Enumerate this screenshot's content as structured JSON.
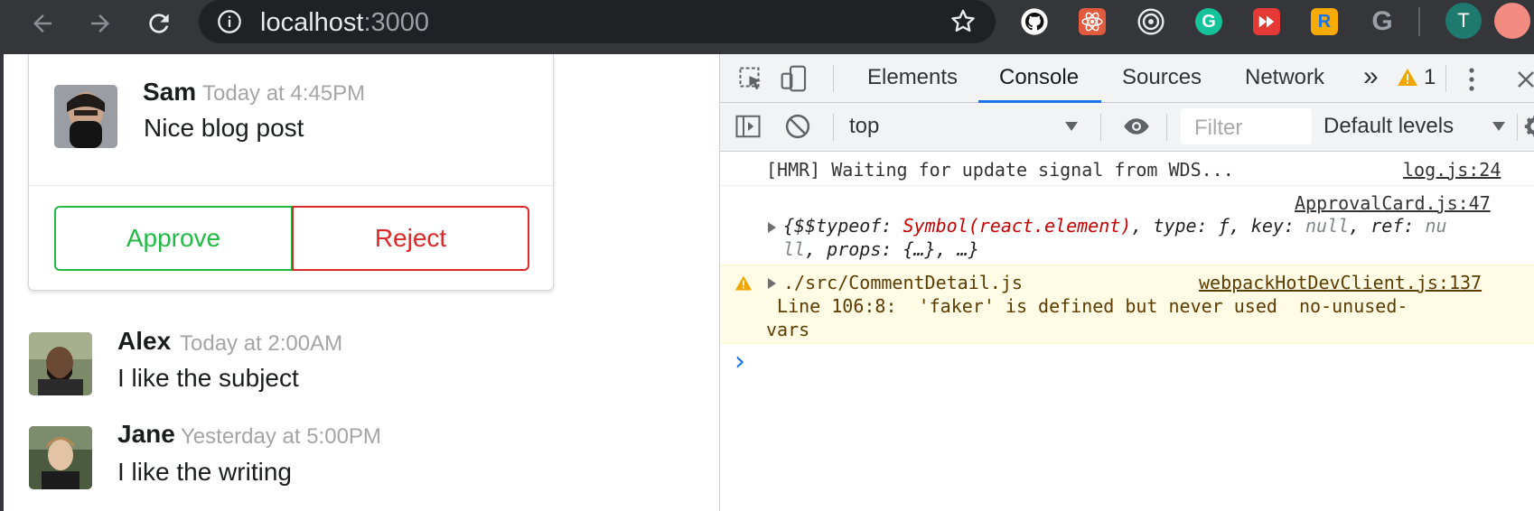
{
  "browser": {
    "url_host": "localhost",
    "url_port": ":3000",
    "profile_initial": "T",
    "extensions": [
      "github-icon",
      "react-icon",
      "radar-icon",
      "grammarly-icon",
      "fast-forward-icon",
      "refresh-r-icon",
      "google-icon"
    ]
  },
  "approval_card": {
    "author": "Sam",
    "time": "Today at 4:45PM",
    "text": "Nice blog post",
    "approve_label": "Approve",
    "reject_label": "Reject",
    "approve_color": "#21ba45",
    "reject_color": "#db2828"
  },
  "comments": [
    {
      "author": "Alex",
      "time": "Today at 2:00AM",
      "text": "I like the subject"
    },
    {
      "author": "Jane",
      "time": "Yesterday at 5:00PM",
      "text": "I like the writing"
    }
  ],
  "devtools": {
    "tabs": [
      "Elements",
      "Console",
      "Sources",
      "Network"
    ],
    "active_tab": "Console",
    "more_tabs": "»",
    "warning_count": "1",
    "context": "top",
    "filter_placeholder": "Filter",
    "levels": "Default levels",
    "messages": {
      "hmr": {
        "text": "[HMR] Waiting for update signal from WDS...",
        "source": "log.js:24"
      },
      "object": {
        "source": "ApprovalCard.js:47",
        "line1_a": "{$$typeof: ",
        "line1_b": "Symbol(react.element)",
        "line1_c": ", type: ",
        "line1_d": "ƒ",
        "line1_e": ", key: ",
        "line1_f": "null",
        "line1_g": ", ref: ",
        "line1_h": "nu",
        "line2_a": "ll",
        "line2_b": ", props: ",
        "line2_c": "{…}, …}"
      },
      "warning": {
        "source": "webpackHotDevClient.js:137",
        "line1": "./src/CommentDetail.js",
        "line2": " Line 106:8:  'faker' is defined but never used  no-unused-",
        "line3": "vars"
      }
    },
    "prompt": "›"
  }
}
